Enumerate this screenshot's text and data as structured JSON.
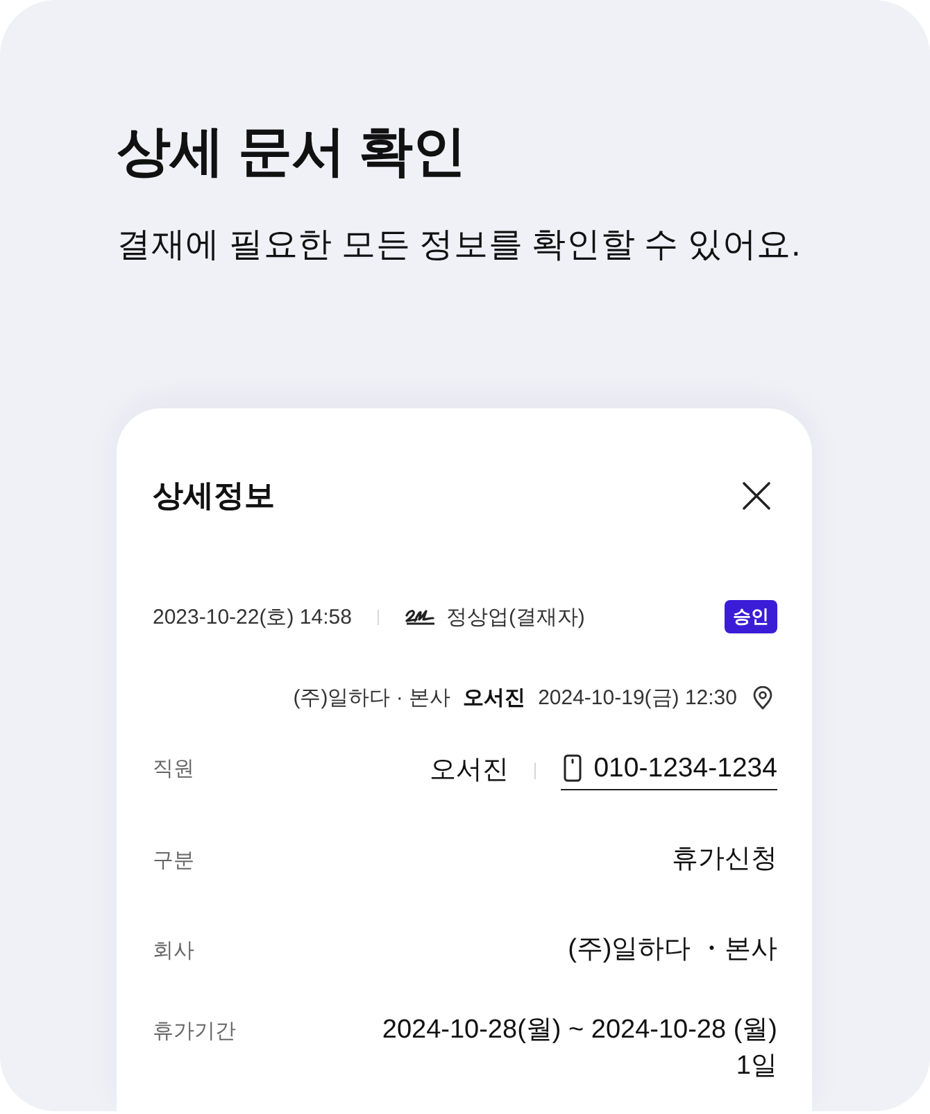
{
  "heading": {
    "title": "상세 문서 확인",
    "subtitle": "결재에 필요한 모든 정보를 확인할 수 있어요."
  },
  "detail_panel": {
    "title": "상세정보",
    "approval": {
      "datetime": "2023-10-22(호) 14:58",
      "approver": "정상업(결재자)",
      "status": "승인"
    },
    "request": {
      "company": "(주)일하다 · 본사",
      "name": "오서진",
      "datetime": "2024-10-19(금) 12:30"
    },
    "fields": [
      {
        "kind": "contact",
        "label": "직원",
        "value": "오서진",
        "phone": "010-1234-1234"
      },
      {
        "kind": "text",
        "label": "구분",
        "value": "휴가신청"
      },
      {
        "kind": "text",
        "label": "회사",
        "value": "(주)일하다 ・본사"
      },
      {
        "kind": "period",
        "label": "휴가기간",
        "value": "2024-10-28(월) ~ 2024-10-28 (월)",
        "duration": "1일"
      }
    ]
  }
}
